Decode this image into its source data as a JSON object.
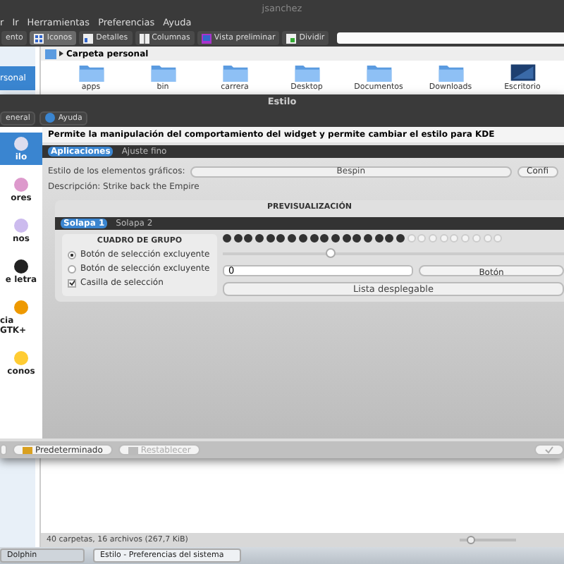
{
  "dolphin": {
    "title": "jsanchez",
    "menu": [
      "r",
      "Ir",
      "Herramientas",
      "Preferencias",
      "Ayuda"
    ],
    "toolbar": [
      {
        "label": "ento",
        "selected": false
      },
      {
        "label": "Iconos",
        "selected": true
      },
      {
        "label": "Detalles",
        "selected": false
      },
      {
        "label": "Columnas",
        "selected": false
      },
      {
        "label": "Vista preliminar",
        "selected": false
      },
      {
        "label": "Dividir",
        "selected": false
      }
    ],
    "places": [
      {
        "label": "rsonal",
        "selected": true
      }
    ],
    "location": "Carpeta personal",
    "files": [
      {
        "name": "apps",
        "kind": "folder"
      },
      {
        "name": "bin",
        "kind": "folder"
      },
      {
        "name": "carrera",
        "kind": "folder"
      },
      {
        "name": "Desktop",
        "kind": "folder"
      },
      {
        "name": "Documentos",
        "kind": "folder"
      },
      {
        "name": "Downloads",
        "kind": "folder"
      },
      {
        "name": "Escritorio",
        "kind": "screen"
      }
    ],
    "status": "40 carpetas, 16 archivos (267,7 KiB)",
    "zoom": {
      "level": 0.2
    }
  },
  "estilo": {
    "title": "Estilo",
    "toolbar": [
      "eneral",
      "Ayuda"
    ],
    "sidebar": [
      {
        "label": "ilo",
        "selected": true
      },
      {
        "label": "ores",
        "selected": false
      },
      {
        "label": "nos",
        "selected": false
      },
      {
        "label": "e letra",
        "selected": false
      },
      {
        "label": "cia GTK+",
        "selected": false
      },
      {
        "label": "conos",
        "selected": false
      }
    ],
    "header": "Permite la manipulación del comportamiento del widget y permite cambiar el estilo para KDE",
    "tabs": [
      {
        "label": "Aplicaciones",
        "selected": true
      },
      {
        "label": "Ajuste fino",
        "selected": false
      }
    ],
    "style_label": "Estilo de los elementos gráficos:",
    "style_value": "Bespin",
    "configure": "Confi",
    "description": "Descripción: Strike back the Empire",
    "preview": {
      "title": "PREVISUALIZACIÓN",
      "tabs": [
        {
          "label": "Solapa 1",
          "selected": true
        },
        {
          "label": "Solapa 2",
          "selected": false
        }
      ],
      "group_title": "CUADRO DE GRUPO",
      "options": [
        {
          "kind": "radio",
          "label": "Botón de selección excluyente",
          "checked": true
        },
        {
          "kind": "radio",
          "label": "Botón de selección excluyente",
          "checked": false
        },
        {
          "kind": "checkbox",
          "label": "Casilla de selección",
          "checked": true
        }
      ],
      "progress": {
        "level": 0.65
      },
      "slider": {
        "level": 0.3
      },
      "spin_value": "0",
      "button": "Botón",
      "combo": "Lista desplegable"
    },
    "buttons": [
      {
        "label": "Predeterminado",
        "disabled": false
      },
      {
        "label": "Restablecer",
        "disabled": true
      }
    ]
  },
  "taskbar": [
    {
      "label": "Dolphin",
      "selected": false
    },
    {
      "label": "Estilo - Preferencias del sistema",
      "selected": true
    }
  ]
}
